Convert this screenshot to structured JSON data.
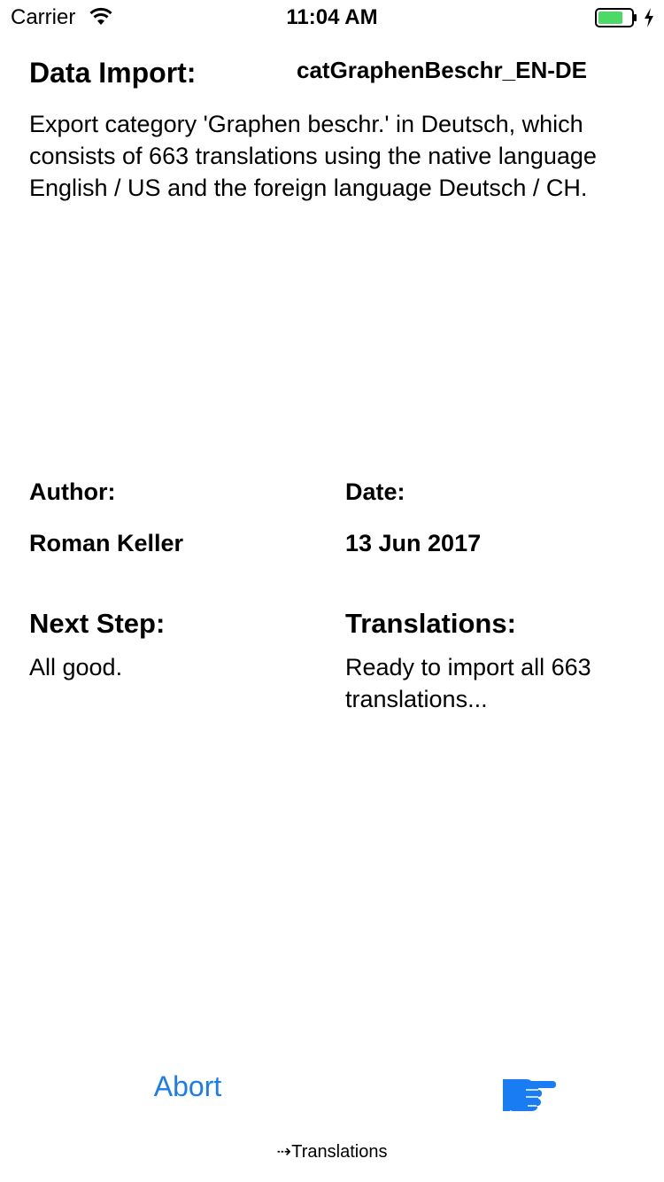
{
  "status_bar": {
    "carrier": "Carrier",
    "time": "11:04 AM",
    "battery_level": 0.75,
    "battery_color": "#4cd964"
  },
  "header": {
    "title": "Data Import:",
    "file_name": "catGraphenBeschr_EN-DE"
  },
  "description": "Export category 'Graphen beschr.' in Deutsch, which consists of 663 translations using the native language English / US and the foreign language Deutsch / CH.",
  "meta": {
    "author_label": "Author:",
    "author_value": "Roman Keller",
    "date_label": "Date:",
    "date_value": "13 Jun 2017"
  },
  "next_step": {
    "title": "Next Step:",
    "text": "All good."
  },
  "translations": {
    "title": "Translations:",
    "text": "Ready to import all 663 translations..."
  },
  "actions": {
    "abort_label": "Abort",
    "next_icon": "pointing-hand-icon",
    "accent_color": "#1a7cf2"
  },
  "footer": {
    "label": "⇢Translations"
  }
}
